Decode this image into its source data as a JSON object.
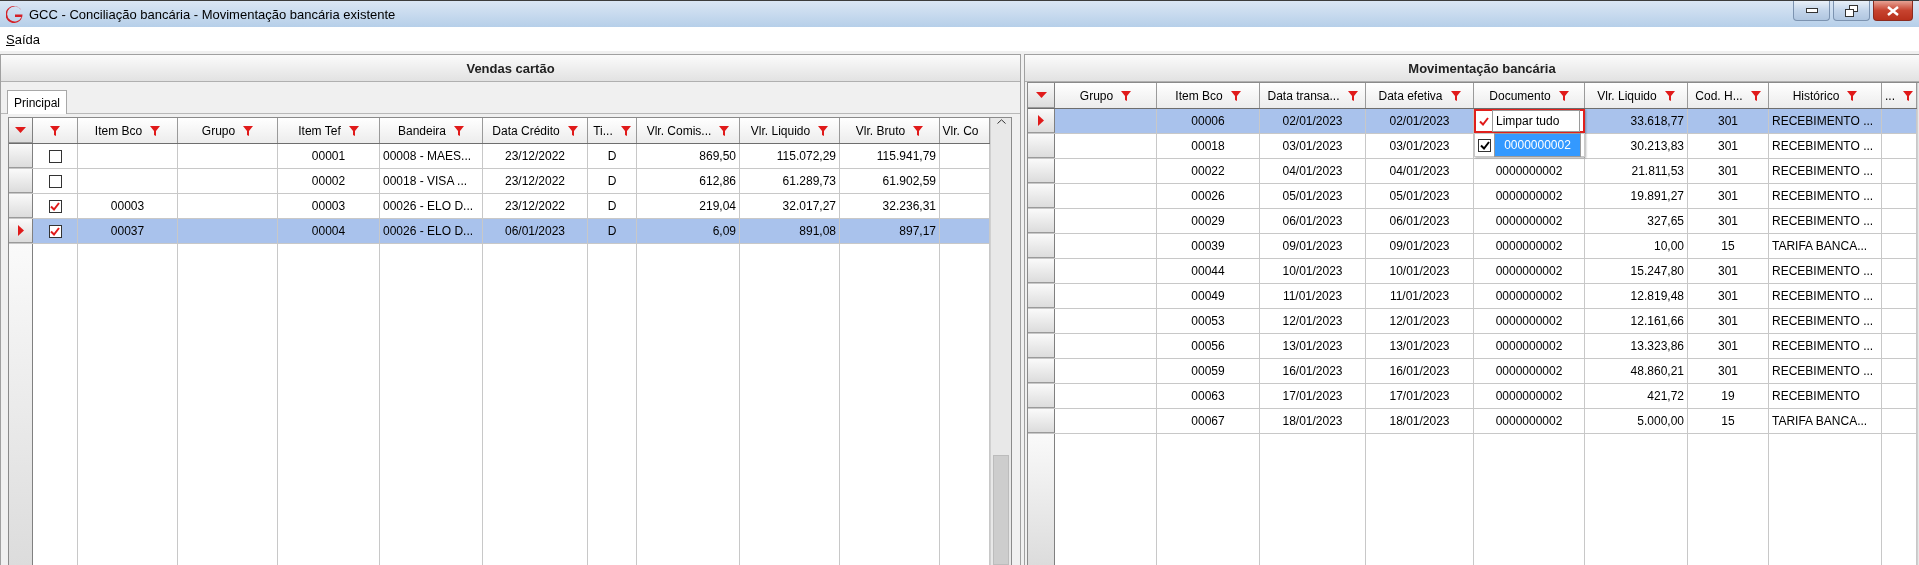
{
  "window": {
    "title": "GCC - Conciliação bancária - Movimentação bancária existente"
  },
  "menu": [
    {
      "label": "Saída"
    }
  ],
  "left_panel": {
    "title": "Vendas cartão",
    "tabs": [
      {
        "label": "Principal",
        "selected": true
      }
    ],
    "table": {
      "columns": [
        {
          "label": "Item Bco"
        },
        {
          "label": "Grupo"
        },
        {
          "label": "Item Tef"
        },
        {
          "label": "Bandeira"
        },
        {
          "label": "Data Crédito"
        },
        {
          "label": "Ti..."
        },
        {
          "label": "Vlr. Comis..."
        },
        {
          "label": "Vlr. Liquido"
        },
        {
          "label": "Vlr. Bruto"
        },
        {
          "label": "Vlr. Co"
        }
      ],
      "rows": [
        {
          "current": false,
          "checked": false,
          "item_tef": "00001",
          "bandeira": "00008 - MAES...",
          "data_credito": "23/12/2022",
          "ti": "D",
          "vlr_comissao": "869,50",
          "vlr_liquido": "115.072,29",
          "vlr_bruto": "115.941,79"
        },
        {
          "current": false,
          "checked": false,
          "item_tef": "00002",
          "bandeira": "00018 - VISA ...",
          "data_credito": "23/12/2022",
          "ti": "D",
          "vlr_comissao": "612,86",
          "vlr_liquido": "61.289,73",
          "vlr_bruto": "61.902,59"
        },
        {
          "current": false,
          "checked": true,
          "item_bco": "00003",
          "item_tef": "00003",
          "bandeira": "00026 - ELO D...",
          "data_credito": "23/12/2022",
          "ti": "D",
          "vlr_comissao": "219,04",
          "vlr_liquido": "32.017,27",
          "vlr_bruto": "32.236,31"
        },
        {
          "current": true,
          "checked": true,
          "item_bco": "00037",
          "item_tef": "00004",
          "bandeira": "00026 - ELO D...",
          "data_credito": "06/01/2023",
          "ti": "D",
          "vlr_comissao": "6,09",
          "vlr_liquido": "891,08",
          "vlr_bruto": "897,17"
        }
      ]
    }
  },
  "right_panel": {
    "title": "Movimentação bancária",
    "table": {
      "columns": [
        {
          "label": "Grupo"
        },
        {
          "label": "Item Bco"
        },
        {
          "label": "Data transa..."
        },
        {
          "label": "Data efetiva"
        },
        {
          "label": "Documento"
        },
        {
          "label": "Vlr. Liquido"
        },
        {
          "label": "Cod. H..."
        },
        {
          "label": "Histórico"
        },
        {
          "label": "..."
        }
      ],
      "rows": [
        {
          "current": true,
          "item_bco": "00006",
          "data_transacao": "02/01/2023",
          "data_efetiva": "02/01/2023",
          "vlr_liquido": "33.618,77",
          "cod_h": "301",
          "historico": "RECEBIMENTO ..."
        },
        {
          "current": false,
          "item_bco": "00018",
          "data_transacao": "03/01/2023",
          "data_efetiva": "03/01/2023",
          "vlr_liquido": "30.213,83",
          "cod_h": "301",
          "historico": "RECEBIMENTO ..."
        },
        {
          "current": false,
          "item_bco": "00022",
          "data_transacao": "04/01/2023",
          "data_efetiva": "04/01/2023",
          "documento": "0000000002",
          "vlr_liquido": "21.811,53",
          "cod_h": "301",
          "historico": "RECEBIMENTO ..."
        },
        {
          "current": false,
          "item_bco": "00026",
          "data_transacao": "05/01/2023",
          "data_efetiva": "05/01/2023",
          "documento": "0000000002",
          "vlr_liquido": "19.891,27",
          "cod_h": "301",
          "historico": "RECEBIMENTO ..."
        },
        {
          "current": false,
          "item_bco": "00029",
          "data_transacao": "06/01/2023",
          "data_efetiva": "06/01/2023",
          "documento": "0000000002",
          "vlr_liquido": "327,65",
          "cod_h": "301",
          "historico": "RECEBIMENTO ..."
        },
        {
          "current": false,
          "item_bco": "00039",
          "data_transacao": "09/01/2023",
          "data_efetiva": "09/01/2023",
          "documento": "0000000002",
          "vlr_liquido": "10,00",
          "cod_h": "15",
          "historico": "TARIFA BANCA..."
        },
        {
          "current": false,
          "item_bco": "00044",
          "data_transacao": "10/01/2023",
          "data_efetiva": "10/01/2023",
          "documento": "0000000002",
          "vlr_liquido": "15.247,80",
          "cod_h": "301",
          "historico": "RECEBIMENTO ..."
        },
        {
          "current": false,
          "item_bco": "00049",
          "data_transacao": "11/01/2023",
          "data_efetiva": "11/01/2023",
          "documento": "0000000002",
          "vlr_liquido": "12.819,48",
          "cod_h": "301",
          "historico": "RECEBIMENTO ..."
        },
        {
          "current": false,
          "item_bco": "00053",
          "data_transacao": "12/01/2023",
          "data_efetiva": "12/01/2023",
          "documento": "0000000002",
          "vlr_liquido": "12.161,66",
          "cod_h": "301",
          "historico": "RECEBIMENTO ..."
        },
        {
          "current": false,
          "item_bco": "00056",
          "data_transacao": "13/01/2023",
          "data_efetiva": "13/01/2023",
          "documento": "0000000002",
          "vlr_liquido": "13.323,86",
          "cod_h": "301",
          "historico": "RECEBIMENTO ..."
        },
        {
          "current": false,
          "item_bco": "00059",
          "data_transacao": "16/01/2023",
          "data_efetiva": "16/01/2023",
          "documento": "0000000002",
          "vlr_liquido": "48.860,21",
          "cod_h": "301",
          "historico": "RECEBIMENTO ..."
        },
        {
          "current": false,
          "item_bco": "00063",
          "data_transacao": "17/01/2023",
          "data_efetiva": "17/01/2023",
          "documento": "0000000002",
          "vlr_liquido": "421,72",
          "cod_h": "19",
          "historico": "RECEBIMENTO"
        },
        {
          "current": false,
          "item_bco": "00067",
          "data_transacao": "18/01/2023",
          "data_efetiva": "18/01/2023",
          "documento": "0000000002",
          "vlr_liquido": "5.000,00",
          "cod_h": "15",
          "historico": "TARIFA BANCA..."
        }
      ]
    },
    "filter_popup": {
      "items": [
        {
          "kind": "clear",
          "label": "Limpar tudo",
          "focused": true,
          "selected": false
        },
        {
          "kind": "option",
          "label": "0000000002",
          "checked": true,
          "focused": false,
          "selected": true
        }
      ]
    }
  }
}
